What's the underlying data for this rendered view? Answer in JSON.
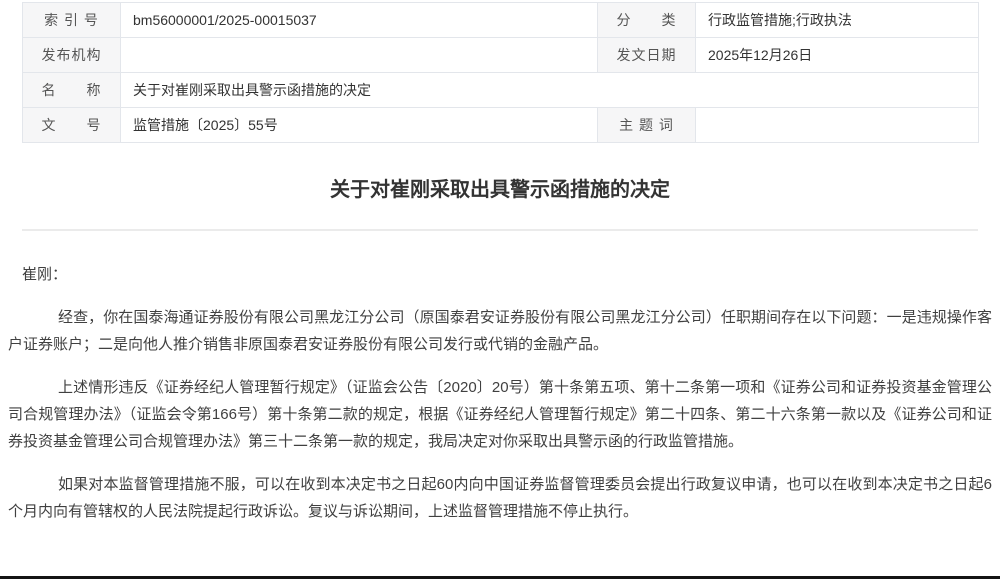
{
  "colors": {
    "table_border": "#e3e6eb",
    "label_bg": "#f6f6f7",
    "footer_bar": "#141414"
  },
  "meta_table": {
    "index_label": "索 引 号",
    "index_value": "bm56000001/2025-00015037",
    "category_label": "分　　类",
    "category_value": "行政监管措施;行政执法",
    "publisher_label": "发布机构",
    "publisher_value": "",
    "pub_date_label": "发文日期",
    "pub_date_value": "2025年12月26日",
    "name_label": "名　　称",
    "name_value": "关于对崔刚采取出具警示函措施的决定",
    "doc_no_label": "文　　号",
    "doc_no_value": "监管措施〔2025〕55号",
    "subject_label": "主 题 词",
    "subject_value": ""
  },
  "document": {
    "title": "关于对崔刚采取出具警示函措施的决定",
    "salutation": "崔刚：",
    "paragraphs": [
      "经查，你在国泰海通证券股份有限公司黑龙江分公司（原国泰君安证券股份有限公司黑龙江分公司）任职期间存在以下问题：一是违规操作客户证券账户；二是向他人推介销售非原国泰君安证券股份有限公司发行或代销的金融产品。",
      "上述情形违反《证券经纪人管理暂行规定》（证监会公告〔2020〕20号）第十条第五项、第十二条第一项和《证券公司和证券投资基金管理公司合规管理办法》（证监会令第166号）第十条第二款的规定，根据《证券经纪人管理暂行规定》第二十四条、第二十六条第一款以及《证券公司和证券投资基金管理公司合规管理办法》第三十二条第一款的规定，我局决定对你采取出具警示函的行政监管措施。",
      "如果对本监督管理措施不服，可以在收到本决定书之日起60内向中国证券监督管理委员会提出行政复议申请，也可以在收到本决定书之日起6个月内向有管辖权的人民法院提起行政诉讼。复议与诉讼期间，上述监督管理措施不停止执行。"
    ]
  }
}
